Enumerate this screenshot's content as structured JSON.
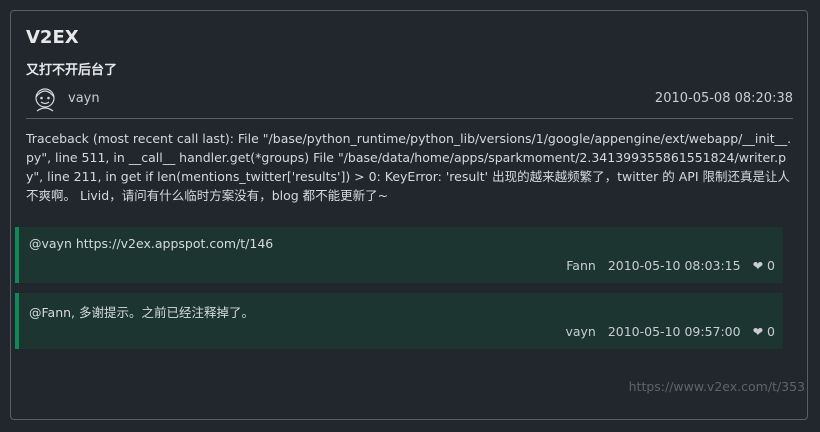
{
  "site": {
    "title": "V2EX"
  },
  "topic": {
    "title": "又打不开后台了",
    "author": "vayn",
    "time": "2010-05-08 08:20:38",
    "content": "Traceback (most recent call last): File \"/base/python_runtime/python_lib/versions/1/google/appengine/ext/webapp/__init__.py\", line 511, in __call__ handler.get(*groups) File \"/base/data/home/apps/sparkmoment/2.341399355861551824/writer.py\", line 211, in get if len(mentions_twitter['results']) > 0: KeyError: 'result' 出现的越来越频繁了，twitter 的 API 限制还真是让人不爽啊。 Livid，请问有什么临时方案没有，blog 都不能更新了~"
  },
  "replies": [
    {
      "text": "@vayn https://v2ex.appspot.com/t/146",
      "user": "Fann",
      "time": "2010-05-10 08:03:15",
      "likes": "❤ 0"
    },
    {
      "text": "@Fann, 多谢提示。之前已经注释掉了。",
      "user": "vayn",
      "time": "2010-05-10 09:57:00",
      "likes": "❤ 0"
    }
  ],
  "footer": {
    "url": "https://www.v2ex.com/t/353"
  },
  "colors": {
    "background": "#22262d",
    "reply_bg": "#1d3531",
    "reply_accent": "#0f8a55",
    "border": "#5a5f66"
  },
  "icons": {
    "avatar": "avatar-icon"
  }
}
